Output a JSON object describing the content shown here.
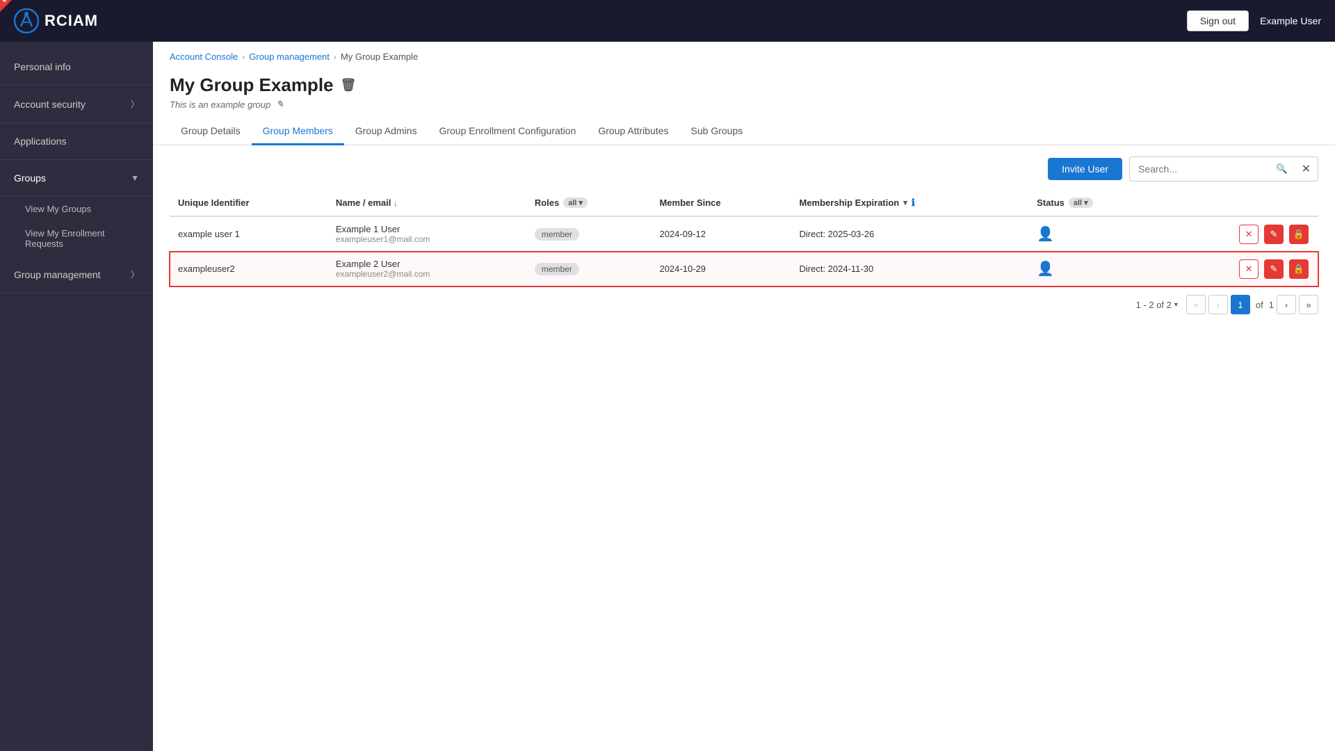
{
  "header": {
    "logo_text": "RCIAM",
    "demo_label": "Demo",
    "sign_out_label": "Sign out",
    "user_name": "Example User"
  },
  "sidebar": {
    "items": [
      {
        "id": "personal-info",
        "label": "Personal info",
        "has_chevron": false
      },
      {
        "id": "account-security",
        "label": "Account security",
        "has_chevron": true
      },
      {
        "id": "applications",
        "label": "Applications",
        "has_chevron": false
      },
      {
        "id": "groups",
        "label": "Groups",
        "has_chevron": true,
        "expanded": true
      }
    ],
    "sub_items": [
      {
        "id": "view-my-groups",
        "label": "View My Groups"
      },
      {
        "id": "view-enrollment-requests",
        "label": "View My Enrollment Requests"
      }
    ],
    "group_management": {
      "label": "Group management",
      "has_chevron": true
    }
  },
  "breadcrumb": {
    "items": [
      {
        "label": "Account Console",
        "link": true
      },
      {
        "label": "Group management",
        "link": true
      },
      {
        "label": "My Group Example",
        "link": false
      }
    ]
  },
  "page": {
    "title": "My Group Example",
    "subtitle": "This is an example group",
    "tabs": [
      {
        "id": "group-details",
        "label": "Group Details",
        "active": false
      },
      {
        "id": "group-members",
        "label": "Group Members",
        "active": true
      },
      {
        "id": "group-admins",
        "label": "Group Admins",
        "active": false
      },
      {
        "id": "group-enrollment-config",
        "label": "Group Enrollment Configuration",
        "active": false
      },
      {
        "id": "group-attributes",
        "label": "Group Attributes",
        "active": false
      },
      {
        "id": "sub-groups",
        "label": "Sub Groups",
        "active": false
      }
    ]
  },
  "toolbar": {
    "invite_user_label": "Invite User",
    "search_placeholder": "Search..."
  },
  "table": {
    "columns": [
      {
        "id": "unique-identifier",
        "label": "Unique Identifier"
      },
      {
        "id": "name-email",
        "label": "Name / email",
        "sortable": true
      },
      {
        "id": "roles",
        "label": "Roles",
        "filter": "all"
      },
      {
        "id": "member-since",
        "label": "Member Since"
      },
      {
        "id": "membership-expiration",
        "label": "Membership Expiration",
        "sortable": true,
        "info": true
      },
      {
        "id": "status",
        "label": "Status",
        "filter": "all"
      }
    ],
    "rows": [
      {
        "id": "row-1",
        "unique_identifier": "example user 1",
        "name": "Example 1 User",
        "email": "exampleuser1@mail.com",
        "role": "member",
        "member_since": "2024-09-12",
        "membership_expiration": "Direct: 2025-03-26",
        "highlighted": false
      },
      {
        "id": "row-2",
        "unique_identifier": "exampleuser2",
        "name": "Example 2 User",
        "email": "exampleuser2@mail.com",
        "role": "member",
        "member_since": "2024-10-29",
        "membership_expiration": "Direct: 2024-11-30",
        "highlighted": true
      }
    ]
  },
  "pagination": {
    "summary": "1 - 2 of 2",
    "current_page": "1",
    "total_pages": "1"
  }
}
